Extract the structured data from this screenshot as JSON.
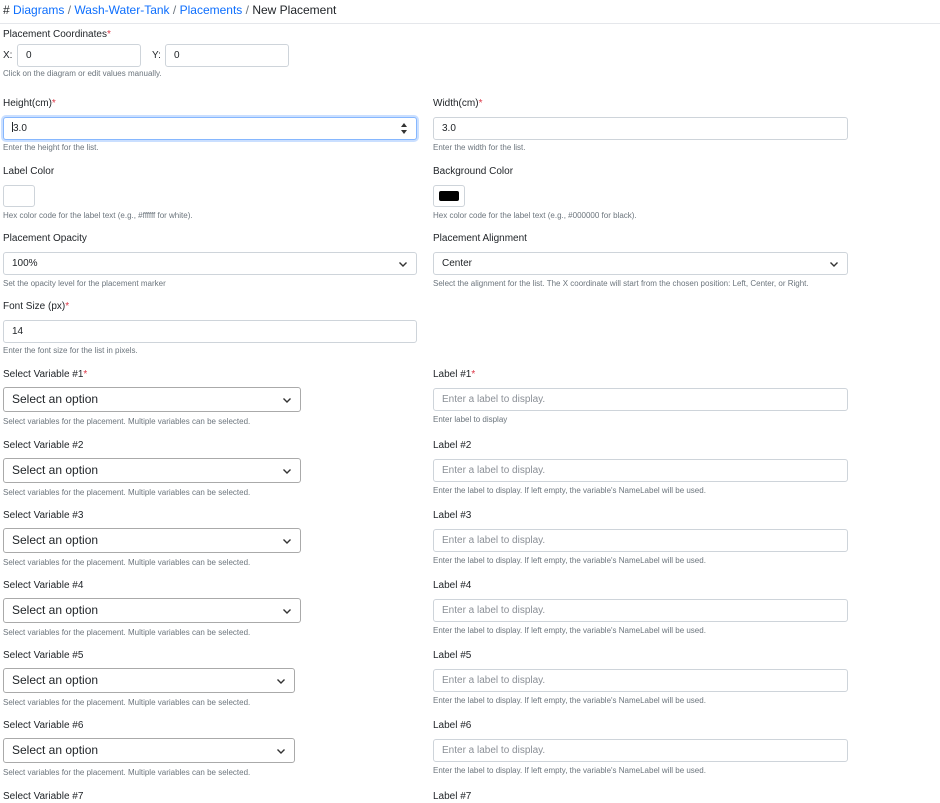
{
  "breadcrumb": {
    "hash": "#",
    "items": [
      "Diagrams",
      "Wash-Water-Tank",
      "Placements",
      "New Placement"
    ],
    "separator": "/"
  },
  "coordinates": {
    "label": "Placement Coordinates",
    "x_label": "X:",
    "x_value": "0",
    "y_label": "Y:",
    "y_value": "0",
    "help": "Click on the diagram or edit values manually."
  },
  "height": {
    "label": "Height(cm)",
    "value": "3.0",
    "help": "Enter the height for the list."
  },
  "width": {
    "label": "Width(cm)",
    "value": "3.0",
    "help": "Enter the width for the list."
  },
  "label_color": {
    "label": "Label Color",
    "value": "#ffffff",
    "help": "Hex color code for the label text (e.g., #ffffff for white)."
  },
  "background_color": {
    "label": "Background Color",
    "value": "#000000",
    "help": "Hex color code for the label text (e.g., #000000 for black)."
  },
  "opacity": {
    "label": "Placement Opacity",
    "value": "100%",
    "help": "Set the opacity level for the placement marker"
  },
  "alignment": {
    "label": "Placement Alignment",
    "value": "Center",
    "help": "Select the alignment for the list. The X coordinate will start from the chosen position: Left, Center, or Right."
  },
  "font_size": {
    "label": "Font Size (px)",
    "value": "14",
    "help": "Enter the font size for the list in pixels."
  },
  "variables": {
    "select_placeholder": "Select an option",
    "select_help": "Select variables for the placement. Multiple variables can be selected.",
    "label_placeholder": "Enter a label to display.",
    "label_help_first": "Enter label to display",
    "label_help": "Enter the label to display. If left empty, the variable's NameLabel will be used.",
    "rows": [
      {
        "select_label": "Select Variable #1",
        "label_label": "Label #1"
      },
      {
        "select_label": "Select Variable #2",
        "label_label": "Label #2"
      },
      {
        "select_label": "Select Variable #3",
        "label_label": "Label #3"
      },
      {
        "select_label": "Select Variable #4",
        "label_label": "Label #4"
      },
      {
        "select_label": "Select Variable #5",
        "label_label": "Label #5"
      },
      {
        "select_label": "Select Variable #6",
        "label_label": "Label #6"
      },
      {
        "select_label": "Select Variable #7",
        "label_label": "Label #7"
      }
    ]
  },
  "required_mark": "*",
  "colors": {
    "link": "#0d6efd",
    "required": "#dc3545",
    "focus": "#86b7fe"
  },
  "icons": {
    "select": "chevron-down-icon",
    "number": "spinner-arrows-icon"
  }
}
